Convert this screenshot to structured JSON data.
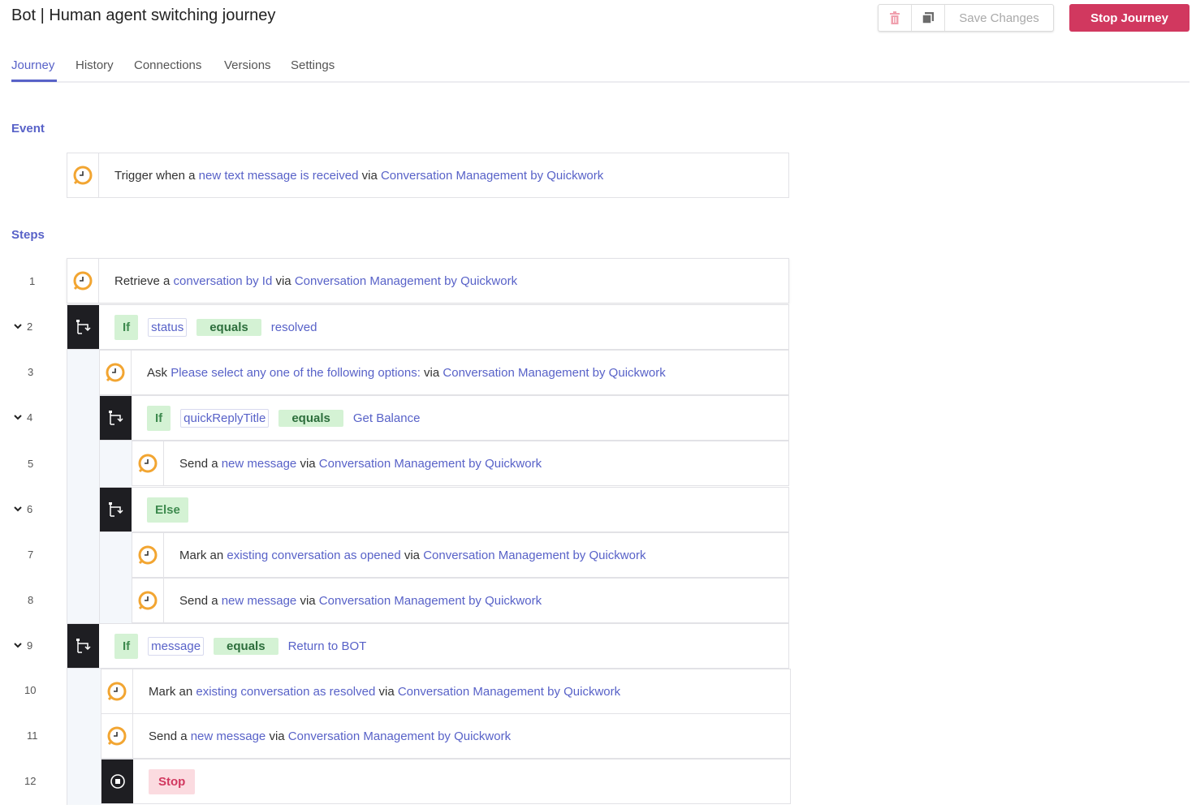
{
  "header": {
    "title": "Bot | Human agent switching journey",
    "save_label": "Save Changes",
    "stop_label": "Stop Journey",
    "delete_icon": "trash-icon",
    "copy_icon": "copy-icon"
  },
  "tabs": [
    "Journey",
    "History",
    "Connections",
    "Versions",
    "Settings"
  ],
  "sections": {
    "event": "Event",
    "steps": "Steps"
  },
  "event": {
    "prefix": "Trigger when a ",
    "action": "new text message is received",
    "via": " via ",
    "app": "Conversation Management by Quickwork"
  },
  "steps": [
    {
      "num": "1",
      "prefix": "Retrieve a ",
      "action": "conversation by Id",
      "via": " via ",
      "app": "Conversation Management by Quickwork"
    },
    {
      "num": "2",
      "if": "If",
      "field": "status",
      "op": "equals",
      "value": "resolved"
    },
    {
      "num": "3",
      "prefix": "Ask ",
      "action": "Please select any one of the following options:",
      "via": " via ",
      "app": "Conversation Management by Quickwork"
    },
    {
      "num": "4",
      "if": "If",
      "field": "quickReplyTitle",
      "op": "equals",
      "value": "Get Balance"
    },
    {
      "num": "5",
      "prefix": "Send a ",
      "action": "new message",
      "via": " via ",
      "app": "Conversation Management by Quickwork"
    },
    {
      "num": "6",
      "else": "Else"
    },
    {
      "num": "7",
      "prefix": "Mark an ",
      "action": "existing conversation as opened",
      "via": " via ",
      "app": "Conversation Management by Quickwork"
    },
    {
      "num": "8",
      "prefix": "Send a ",
      "action": "new message",
      "via": " via ",
      "app": "Conversation Management by Quickwork"
    },
    {
      "num": "9",
      "if": "If",
      "field": "message",
      "op": "equals",
      "value": "Return to BOT"
    },
    {
      "num": "10",
      "prefix": "Mark an ",
      "action": "existing conversation as resolved",
      "via": " via ",
      "app": "Conversation Management by Quickwork"
    },
    {
      "num": "11",
      "prefix": "Send a ",
      "action": "new message",
      "via": " via ",
      "app": "Conversation Management by Quickwork"
    },
    {
      "num": "12",
      "stop": "Stop"
    }
  ],
  "colors": {
    "accent": "#5862c8",
    "danger": "#d1385f",
    "app_icon": "#f2a531",
    "branch_bg": "#1e1e22"
  }
}
